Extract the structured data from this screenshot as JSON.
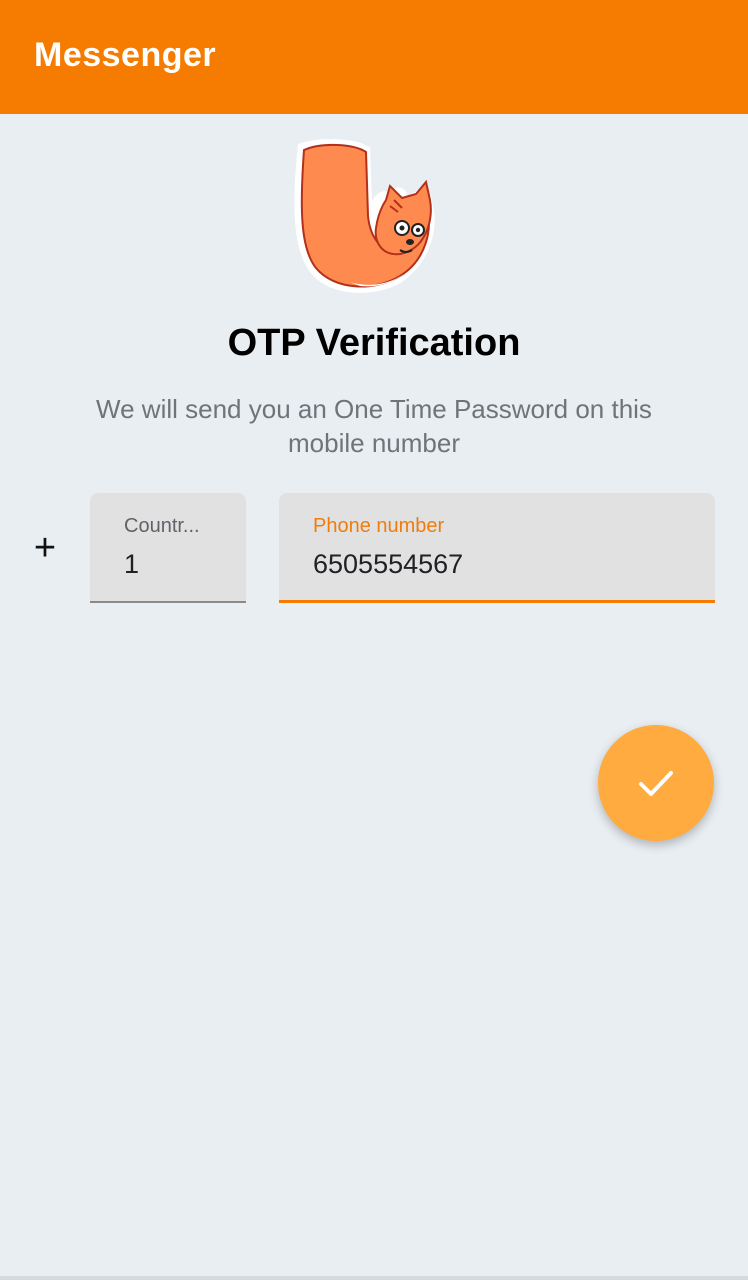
{
  "app_bar": {
    "title": "Messenger",
    "color": "#f57c00"
  },
  "mascot": {
    "icon": "cat-mascot-icon"
  },
  "content": {
    "heading": "OTP Verification",
    "subtitle": "We will send you an One Time Password on this mobile number"
  },
  "form": {
    "prefix": "+",
    "country_code": {
      "label": "Countr...",
      "value": "1"
    },
    "phone": {
      "label": "Phone number",
      "value": "6505554567"
    }
  },
  "fab": {
    "icon": "check-icon",
    "color": "#ffab40"
  }
}
